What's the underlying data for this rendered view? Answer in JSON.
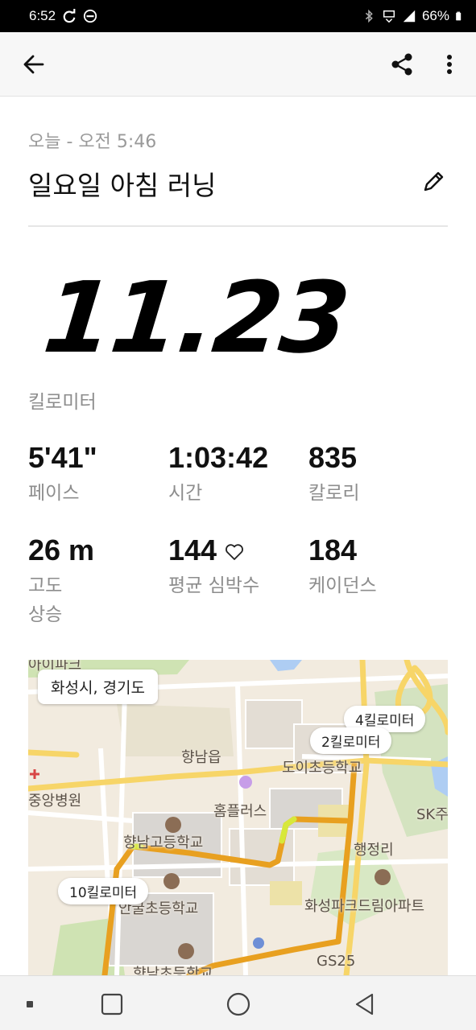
{
  "status_bar": {
    "time": "6:52",
    "battery": "66%",
    "icons": [
      "sync-icon",
      "do-not-disturb-icon",
      "bluetooth-icon",
      "vibrate-icon",
      "signal-icon",
      "battery-icon"
    ]
  },
  "app_bar": {
    "icons": [
      "back-arrow-icon",
      "share-icon",
      "more-vertical-icon"
    ]
  },
  "activity": {
    "date": "오늘 - 오전 5:46",
    "title": "일요일 아침 러닝",
    "distance": "11.23",
    "distance_unit": "킬로미터"
  },
  "stats": [
    {
      "value": "5'41\"",
      "label": "페이스"
    },
    {
      "value": "1:03:42",
      "label": "시간"
    },
    {
      "value": "835",
      "label": "칼로리"
    },
    {
      "value": "26 m",
      "label": "고도\n상승"
    },
    {
      "value": "144",
      "label": "평균 심박수",
      "icon": "heart-outline-icon"
    },
    {
      "value": "184",
      "label": "케이던스"
    }
  ],
  "map": {
    "location": "화성시, 경기도",
    "km_markers": [
      "2킬로미터",
      "4킬로미터",
      "10킬로미터"
    ],
    "labels": {
      "town": "향남읍",
      "school1": "도이초등학교",
      "hospital": "중앙병원",
      "store": "홈플러스",
      "highschool": "향남고등학교",
      "office": "행정리",
      "school2": "안굴초등학교",
      "apartment": "화성파크드림아파트",
      "gs25": "GS25",
      "sk": "SK주",
      "top_left": "아이파크",
      "bottom": "향남초등학교"
    },
    "colors": {
      "route": "#e8a020",
      "route_fast": "#d7e83a",
      "road": "#f7d568",
      "park": "#cfe3b3",
      "water": "#aecdf3"
    }
  },
  "nav_bar": {
    "icons": [
      "dot-icon",
      "recents-square-icon",
      "home-circle-icon",
      "back-triangle-icon"
    ]
  }
}
